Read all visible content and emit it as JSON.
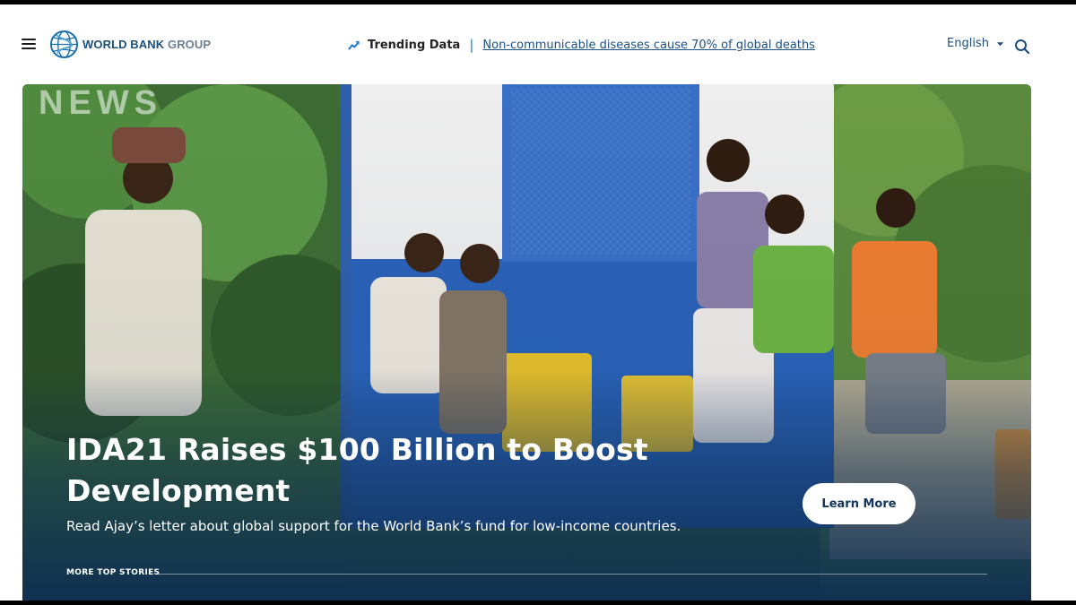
{
  "header": {
    "logo_text_bold": "WORLD BANK",
    "logo_text_light": "GROUP",
    "trending_label": "Trending Data",
    "trending_separator": "|",
    "trending_link": "Non-communicable diseases cause 70% of global deaths",
    "language": "English"
  },
  "hero": {
    "watermark": "NEWS",
    "headline_line1": "IDA21 Raises $100 Billion to Boost",
    "headline_line2": "Development",
    "subtext": "Read Ajay’s letter about global support for the World Bank’s fund for low-income countries.",
    "cta_label": "Learn More",
    "more_top_stories": "MORE TOP STORIES"
  },
  "colors": {
    "brand_blue": "#1a4f7d",
    "link_blue": "#1b4f86",
    "trend_accent": "#1d7bd1",
    "hero_overlay": "#0d2d52"
  },
  "icons": {
    "menu": "hamburger-icon",
    "logo": "globe-logo-icon",
    "trending": "trending-arrow-icon",
    "language_dropdown": "chevron-down-icon",
    "search": "search-icon"
  }
}
